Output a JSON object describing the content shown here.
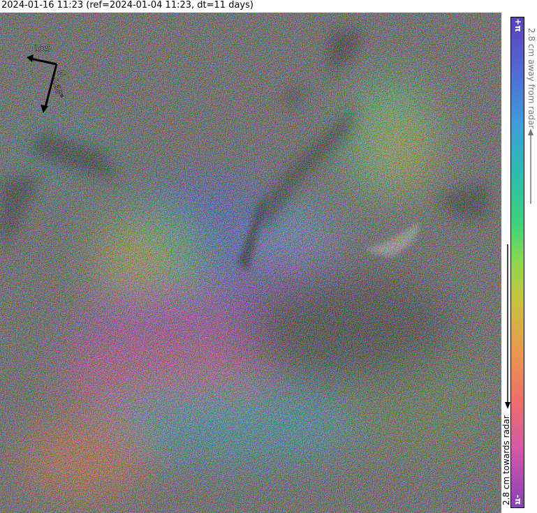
{
  "header": {
    "title": "2024-01-16 11:23 (ref=2024-01-04 11:23, dt=11 days)"
  },
  "compass": {
    "los_label": "LOS",
    "north_label": "N",
    "heading_label": "-168°"
  },
  "colorbar": {
    "top_label": "+π",
    "bottom_label": "-π",
    "away_label": "2.8 cm away from radar",
    "towards_label": "2.8 cm towards radar"
  },
  "colors": {
    "background": "#ffffff",
    "away_text": "#777777",
    "towards_text": "#000000"
  }
}
